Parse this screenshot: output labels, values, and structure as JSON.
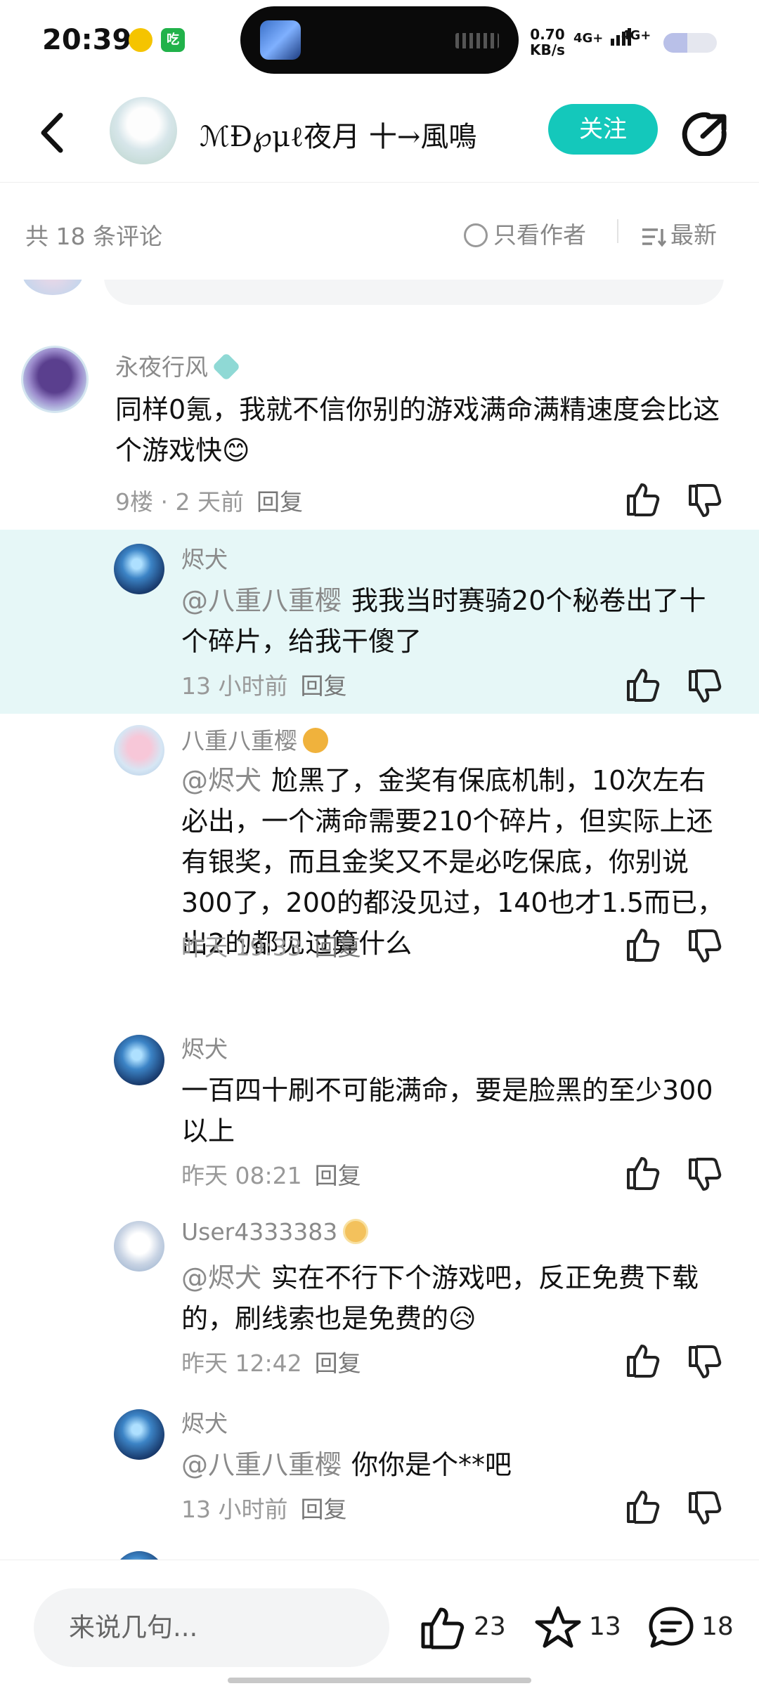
{
  "status_bar": {
    "time": "20:39",
    "app_badge": "吃",
    "net_speed_value": "0.70",
    "net_speed_unit": "KB/s",
    "sim1": "4G+",
    "sim2": "4G+",
    "battery_level": 0.45
  },
  "header": {
    "author_name": "ℳĐ℘μℓ夜月 十→風鳴",
    "follow_label": "关注"
  },
  "sort_bar": {
    "count_label": "共 18 条评论",
    "author_only_label": "只看作者",
    "sort_label": "最新"
  },
  "comments": [
    {
      "name": "永夜行风",
      "text": "同样0氪，我就不信你别的游戏满命满精速度会比这个游戏快😊",
      "meta": "9楼 · 2 天前",
      "reply": "回复"
    },
    {
      "name": "烬犬",
      "mention": "@八重八重樱",
      "text": "我我当时赛骑20个秘卷出了十个碎片，给我干傻了",
      "meta": "13 小时前",
      "reply": "回复"
    },
    {
      "name": "八重八重樱",
      "mention": "@烬犬",
      "text": "尬黑了，金奖有保底机制，10次左右必出，一个满命需要210个碎片，但实际上还有银奖，而且金奖又不是必吃保底，你别说300了，200的都没见过，140也才1.5而已，出2的都见过算什么",
      "meta": "昨天 19:33",
      "reply": "回复"
    },
    {
      "name": "烬犬",
      "mention": "",
      "text": "一百四十刷不可能满命，要是脸黑的至少300以上",
      "meta": "昨天 08:21",
      "reply": "回复"
    },
    {
      "name": "User4333383",
      "mention": "@烬犬",
      "text": "实在不行下个游戏吧，反正免费下载的，刷线索也是免费的😥",
      "meta": "昨天 12:42",
      "reply": "回复"
    },
    {
      "name": "烬犬",
      "mention": "@八重八重樱",
      "text": "你你是个**吧",
      "meta": "13 小时前",
      "reply": "回复"
    }
  ],
  "bottom_bar": {
    "input_placeholder": "来说几句...",
    "likes": "23",
    "favorites": "13",
    "comments": "18"
  },
  "colors": {
    "accent": "#14c8bb",
    "highlight_bg": "#e6f7f7",
    "muted_text": "#8a8a8a"
  }
}
